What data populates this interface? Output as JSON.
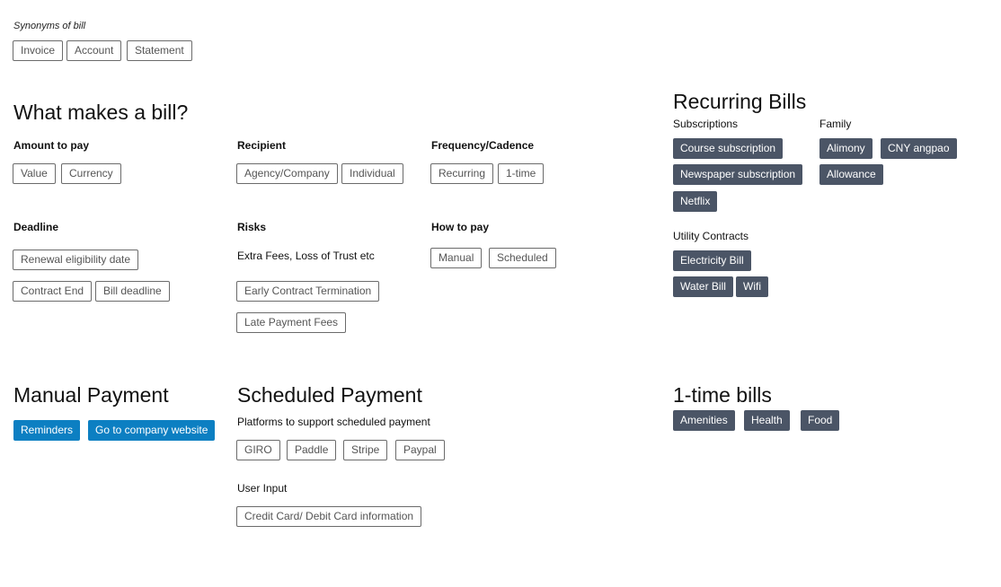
{
  "synonyms": {
    "label": "Synonyms of bill",
    "tags": [
      "Invoice",
      "Account",
      "Statement"
    ]
  },
  "what_makes": {
    "title": "What makes a bill?",
    "amount": {
      "title": "Amount to pay",
      "tags": [
        "Value",
        "Currency"
      ]
    },
    "recipient": {
      "title": "Recipient",
      "tags": [
        "Agency/Company",
        "Individual"
      ]
    },
    "frequency": {
      "title": "Frequency/Cadence",
      "tags": [
        "Recurring",
        "1-time"
      ]
    },
    "deadline": {
      "title": "Deadline",
      "tags": [
        "Renewal eligibility date",
        "Contract End",
        "Bill deadline"
      ]
    },
    "risks": {
      "title": "Risks",
      "note": "Extra Fees, Loss of Trust etc",
      "tags": [
        "Early Contract Termination",
        "Late Payment Fees"
      ]
    },
    "how_to_pay": {
      "title": "How to pay",
      "tags": [
        "Manual",
        "Scheduled"
      ]
    }
  },
  "recurring": {
    "title": "Recurring Bills",
    "subscriptions": {
      "label": "Subscriptions",
      "tags": [
        "Course subscription",
        "Newspaper subscription",
        "Netflix"
      ]
    },
    "family": {
      "label": "Family",
      "tags": [
        "Alimony",
        "CNY angpao",
        "Allowance"
      ]
    },
    "utility": {
      "label": "Utility Contracts",
      "tags": [
        "Electricity Bill",
        "Water Bill",
        "Wifi"
      ]
    }
  },
  "manual": {
    "title": "Manual Payment",
    "buttons": [
      "Reminders",
      "Go to company website"
    ]
  },
  "scheduled": {
    "title": "Scheduled Payment",
    "platforms_label": "Platforms to support scheduled payment",
    "platforms": [
      "GIRO",
      "Paddle",
      "Stripe",
      "Paypal"
    ],
    "input_label": "User Input",
    "input_tags": [
      "Credit Card/ Debit Card information"
    ]
  },
  "one_time": {
    "title": "1-time bills",
    "tags": [
      "Amenities",
      "Health",
      "Food"
    ]
  }
}
